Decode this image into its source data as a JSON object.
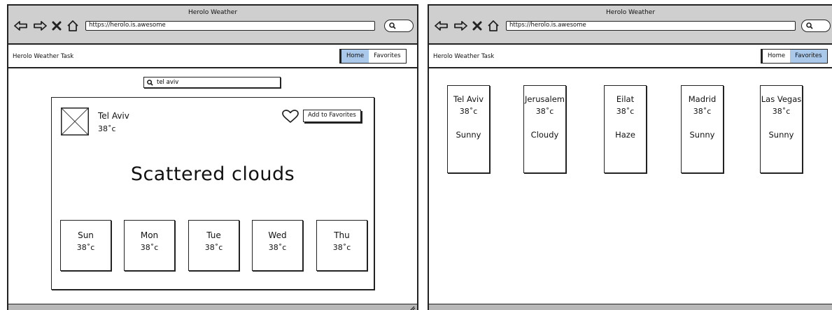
{
  "left_window": {
    "title": "Herolo Weather",
    "url": "https://herolo.is.awesome",
    "app_name": "Herolo Weather Task",
    "nav": {
      "home": "Home",
      "favorites": "Favorites",
      "active": "Home"
    },
    "search": {
      "value": "tel aviv"
    },
    "city": {
      "name": "Tel Aviv",
      "temp": "38˚c"
    },
    "add_to_favorites_label": "Add to Favorites",
    "condition": "Scattered clouds",
    "forecast": [
      {
        "day": "Sun",
        "temp": "38˚c"
      },
      {
        "day": "Mon",
        "temp": "38˚c"
      },
      {
        "day": "Tue",
        "temp": "38˚c"
      },
      {
        "day": "Wed",
        "temp": "38˚c"
      },
      {
        "day": "Thu",
        "temp": "38˚c"
      }
    ]
  },
  "right_window": {
    "title": "Herolo Weather",
    "url": "https://herolo.is.awesome",
    "app_name": "Herolo Weather Task",
    "nav": {
      "home": "Home",
      "favorites": "Favorites",
      "active": "Favorites"
    },
    "favorites": [
      {
        "name": "Tel Aviv",
        "temp": "38˚c",
        "condition": "Sunny"
      },
      {
        "name": "Jerusalem",
        "temp": "38˚c",
        "condition": "Cloudy"
      },
      {
        "name": "Eilat",
        "temp": "38˚c",
        "condition": "Haze"
      },
      {
        "name": "Madrid",
        "temp": "38˚c",
        "condition": "Sunny"
      },
      {
        "name": "Las Vegas",
        "temp": "38˚c",
        "condition": "Sunny"
      }
    ]
  },
  "colors": {
    "chrome_gray": "#cfcfcf",
    "active_nav_blue": "#a9c8ea",
    "status_gray": "#b8b8b8"
  },
  "icons": [
    "back-arrow-icon",
    "forward-arrow-icon",
    "close-icon",
    "home-icon",
    "search-icon",
    "image-placeholder-icon",
    "heart-icon",
    "resize-grip-icon"
  ]
}
